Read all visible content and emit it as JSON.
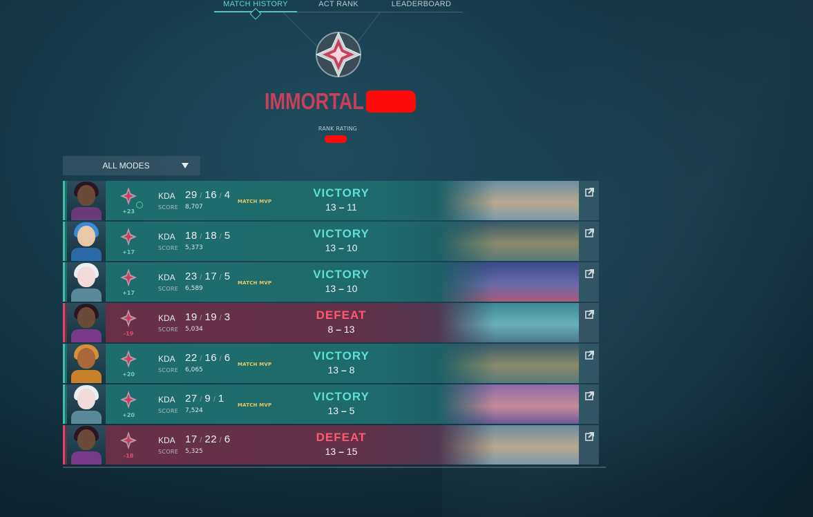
{
  "tabs": [
    {
      "label": "MATCH HISTORY",
      "active": true
    },
    {
      "label": "ACT RANK",
      "active": false
    },
    {
      "label": "LEADERBOARD",
      "active": false
    }
  ],
  "rank": {
    "title": "IMMORTAL 3 #",
    "rating_label": "RANK RATING",
    "title_color": "#c8405c"
  },
  "filter": {
    "label": "ALL MODES",
    "icon": "caret-down-icon"
  },
  "labels": {
    "kda": "KDA",
    "score": "SCORE"
  },
  "colors": {
    "victory": "#5fe0cf",
    "defeat": "#ff5a6f",
    "mvp": "#e8c96a",
    "redaction": "#ff0a0a"
  },
  "matches": [
    {
      "result": "VICTORY",
      "rr_change": "+23",
      "kills": "29",
      "deaths": "16",
      "assists": "4",
      "score": "8,707",
      "mvp": "MATCH MVP",
      "score_us": "13",
      "score_them": "11",
      "rank_up_icon": true
    },
    {
      "result": "VICTORY",
      "rr_change": "+17",
      "kills": "18",
      "deaths": "18",
      "assists": "5",
      "score": "5,373",
      "mvp": "",
      "score_us": "13",
      "score_them": "10"
    },
    {
      "result": "VICTORY",
      "rr_change": "+17",
      "kills": "23",
      "deaths": "17",
      "assists": "5",
      "score": "6,589",
      "mvp": "MATCH MVP",
      "score_us": "13",
      "score_them": "10"
    },
    {
      "result": "DEFEAT",
      "rr_change": "-19",
      "kills": "19",
      "deaths": "19",
      "assists": "3",
      "score": "5,034",
      "mvp": "",
      "score_us": "8",
      "score_them": "13"
    },
    {
      "result": "VICTORY",
      "rr_change": "+20",
      "kills": "22",
      "deaths": "16",
      "assists": "6",
      "score": "6,065",
      "mvp": "MATCH MVP",
      "score_us": "13",
      "score_them": "8"
    },
    {
      "result": "VICTORY",
      "rr_change": "+20",
      "kills": "27",
      "deaths": "9",
      "assists": "1",
      "score": "7,524",
      "mvp": "MATCH MVP",
      "score_us": "13",
      "score_them": "5"
    },
    {
      "result": "DEFEAT",
      "rr_change": "-18",
      "kills": "17",
      "deaths": "22",
      "assists": "6",
      "score": "5,325",
      "mvp": "",
      "score_us": "13",
      "score_them": "15"
    }
  ]
}
